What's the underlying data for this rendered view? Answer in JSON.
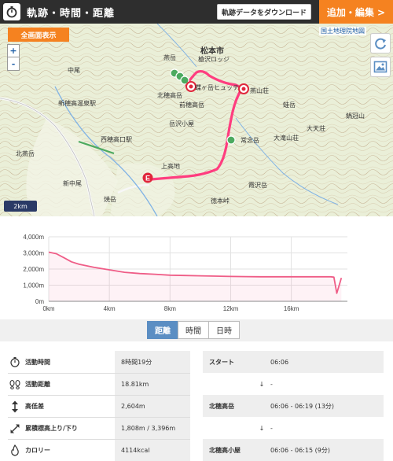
{
  "header": {
    "title": "軌跡・時間・距離",
    "download_label": "軌跡データをダウンロード",
    "edit_label": "追加・編集 >"
  },
  "map": {
    "fullview_label": "全画面表示",
    "zoom_in": "+",
    "zoom_out": "-",
    "attribution": "国土地理院地図",
    "scale_label": "2km",
    "places": [
      {
        "name": "松本市"
      },
      {
        "name": "燕山荘"
      },
      {
        "name": "燕岳"
      },
      {
        "name": "北燕岳"
      },
      {
        "name": "蛙岳"
      },
      {
        "name": "大天荘"
      },
      {
        "name": "北穂高岳"
      },
      {
        "name": "西穂高口駅"
      },
      {
        "name": "新穂高温泉駅"
      },
      {
        "name": "上高地"
      },
      {
        "name": "岳沢小屋"
      },
      {
        "name": "前穂高岳"
      },
      {
        "name": "焼岳"
      },
      {
        "name": "中尾"
      },
      {
        "name": "新中尾"
      },
      {
        "name": "霞沢岳"
      },
      {
        "name": "徳本峠"
      },
      {
        "name": "蝶ヶ岳ヒュッテ"
      },
      {
        "name": "大滝山荘"
      },
      {
        "name": "鍋冠山"
      },
      {
        "name": "常念岳"
      },
      {
        "name": "槍沢ロッジ"
      }
    ],
    "markers": {
      "start": "S",
      "end": "E"
    }
  },
  "chart_data": {
    "type": "area",
    "title": "",
    "xlabel": "",
    "ylabel": "",
    "x_ticks": [
      "0km",
      "4km",
      "8km",
      "12km",
      "16km"
    ],
    "y_ticks": [
      "0m",
      "1,000m",
      "2,000m",
      "3,000m",
      "4,000m"
    ],
    "xlim": [
      0,
      19.7
    ],
    "ylim": [
      0,
      4000
    ],
    "x": [
      0,
      0.5,
      1,
      1.5,
      2,
      3,
      4,
      5,
      6,
      7,
      8,
      9,
      10,
      11,
      12,
      13,
      14,
      15,
      16,
      17,
      18,
      18.6,
      18.81,
      19.0,
      19.3
    ],
    "values": [
      3050,
      2950,
      2700,
      2450,
      2300,
      2100,
      1950,
      1800,
      1720,
      1680,
      1620,
      1600,
      1580,
      1560,
      1540,
      1530,
      1520,
      1520,
      1520,
      1520,
      1520,
      1520,
      1500,
      500,
      1450
    ],
    "color": "#ef5d87"
  },
  "tabs": [
    {
      "label": "距離",
      "active": true
    },
    {
      "label": "時間",
      "active": false
    },
    {
      "label": "日時",
      "active": false
    }
  ],
  "stats": [
    {
      "icon": "stopwatch-icon",
      "label": "活動時間",
      "value": "8時間19分"
    },
    {
      "icon": "footprints-icon",
      "label": "活動距離",
      "value": "18.81km"
    },
    {
      "icon": "vertical-arrows-icon",
      "label": "高低差",
      "value": "2,604m"
    },
    {
      "icon": "diagonal-arrows-icon",
      "label": "累積標高上り/下り",
      "value": "1,808m / 3,396m"
    },
    {
      "icon": "flame-icon",
      "label": "カロリー",
      "value": "4114kcal"
    }
  ],
  "timeline": [
    {
      "type": "point",
      "name": "スタート",
      "time": "06:06"
    },
    {
      "type": "arrow",
      "arrow": "↓",
      "time": "-"
    },
    {
      "type": "point",
      "name": "北穂高岳",
      "time": "06:06 - 06:19 (13分)"
    },
    {
      "type": "arrow",
      "arrow": "↓",
      "time": "-"
    },
    {
      "type": "point",
      "name": "北穂高小屋",
      "time": "06:06 - 06:15 (9分)"
    }
  ]
}
